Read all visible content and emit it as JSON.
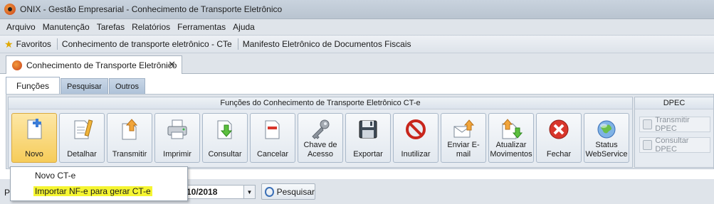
{
  "window": {
    "title": "ONIX - Gestão Empresarial - Conhecimento de Transporte Eletrônico"
  },
  "menu": [
    "Arquivo",
    "Manutenção",
    "Tarefas",
    "Relatórios",
    "Ferramentas",
    "Ajuda"
  ],
  "favorites": {
    "label": "Favoritos",
    "items": [
      "Conhecimento de transporte eletrônico - CTe",
      "Manifesto Eletrônico de Documentos Fiscais"
    ]
  },
  "doc_tab": {
    "label": "Conhecimento de Transporte Eletrônico",
    "close": "✕"
  },
  "inner_tabs": [
    "Funções",
    "Pesquisar",
    "Outros"
  ],
  "ribbon": {
    "group_title": "Funções do Conhecimento de Transporte Eletrônico CT-e",
    "buttons": [
      {
        "label": "Novo",
        "icon": "new-document-icon"
      },
      {
        "label": "Detalhar",
        "icon": "detail-icon"
      },
      {
        "label": "Transmitir",
        "icon": "transmit-icon"
      },
      {
        "label": "Imprimir",
        "icon": "printer-icon"
      },
      {
        "label": "Consultar",
        "icon": "query-icon"
      },
      {
        "label": "Cancelar",
        "icon": "cancel-document-icon"
      },
      {
        "label": "Chave de Acesso",
        "icon": "key-icon"
      },
      {
        "label": "Exportar",
        "icon": "floppy-icon"
      },
      {
        "label": "Inutilizar",
        "icon": "prohibited-icon"
      },
      {
        "label": "Enviar E-mail",
        "icon": "email-icon"
      },
      {
        "label": "Atualizar Movimentos",
        "icon": "refresh-icon"
      },
      {
        "label": "Fechar",
        "icon": "close-circle-icon"
      },
      {
        "label": "Status WebService",
        "icon": "globe-icon"
      }
    ],
    "dpec_title": "DPEC",
    "dpec_buttons": [
      "Transmitir DPEC",
      "Consultar DPEC"
    ]
  },
  "filter": {
    "left_fragment": "P",
    "date_value": "10/2018",
    "search_label": "Pesquisar"
  },
  "popup": {
    "items": [
      "Novo CT-e",
      "Importar NF-e para gerar CT-e"
    ]
  },
  "colors": {
    "active_button": "#f6cc5a",
    "highlight": "#f5f531",
    "ribbon_bg": "#dfe4ea"
  }
}
